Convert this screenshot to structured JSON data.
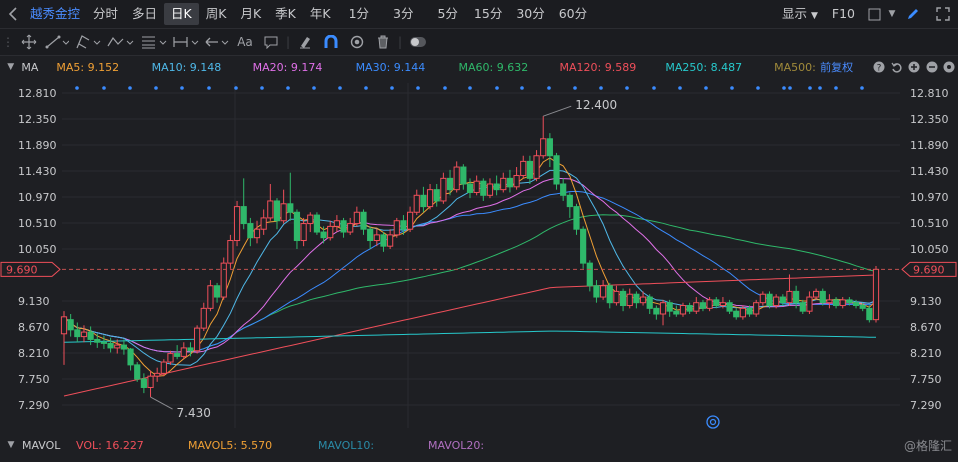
{
  "header": {
    "stock_name": "越秀金控",
    "periods": [
      "分时",
      "多日",
      "日K",
      "周K",
      "月K",
      "季K",
      "年K",
      "1分",
      "3分",
      "5分",
      "15分",
      "30分",
      "60分"
    ],
    "active_period": "日K",
    "display_label": "显示",
    "f10_label": "F10"
  },
  "toolbar": {
    "text_tool": "Aa"
  },
  "indicators": {
    "main_label": "MA",
    "ma5": "MA5: 9.152",
    "ma10": "MA10: 9.148",
    "ma20": "MA20: 9.174",
    "ma30": "MA30: 9.144",
    "ma60": "MA60: 9.632",
    "ma120": "MA120: 9.589",
    "ma250": "MA250: 8.487",
    "ma500": "MA500: ",
    "adjust": "前复权",
    "colors": {
      "ma5": "#f0a035",
      "ma10": "#4fb8e8",
      "ma20": "#e070e8",
      "ma30": "#3b8cff",
      "ma60": "#2fb86a",
      "ma120": "#ef4f5a",
      "ma250": "#27c9cc",
      "ma500": "#a08a3a",
      "up": "#ef4f5a",
      "down": "#2fb86a"
    }
  },
  "volume": {
    "label": "MAVOL",
    "vol": "VOL: 16.227",
    "mavol5": "MAVOL5: 5.570",
    "mavol10": "MAVOL10:",
    "mavol20": "MAVOL20:",
    "colors": {
      "vol": "#ef4f5a",
      "mavol5": "#f0a035",
      "mavol10": "#2a8aa6",
      "mavol20": "#b070c0"
    }
  },
  "watermark": "@格隆汇",
  "chart_data": {
    "type": "candlestick",
    "y_ticks": [
      "12.810",
      "12.350",
      "11.890",
      "11.430",
      "10.970",
      "10.510",
      "10.050",
      "9.690",
      "9.130",
      "8.670",
      "8.210",
      "7.750",
      "7.290"
    ],
    "current_price": "9.690",
    "annotations": {
      "high": "12.400",
      "low": "7.430"
    },
    "ylim": [
      7.0,
      13.0
    ],
    "candles": [
      [
        8.55,
        8.85,
        8.95,
        8.0
      ],
      [
        8.8,
        8.62,
        8.9,
        8.5
      ],
      [
        8.62,
        8.5,
        8.75,
        8.4
      ],
      [
        8.5,
        8.58,
        8.7,
        8.4
      ],
      [
        8.58,
        8.45,
        8.68,
        8.35
      ],
      [
        8.45,
        8.4,
        8.55,
        8.3
      ],
      [
        8.4,
        8.38,
        8.52,
        8.28
      ],
      [
        8.38,
        8.3,
        8.48,
        8.22
      ],
      [
        8.3,
        8.35,
        8.45,
        8.2
      ],
      [
        8.35,
        8.28,
        8.45,
        8.18
      ],
      [
        8.28,
        8.0,
        8.3,
        7.9
      ],
      [
        8.0,
        7.75,
        8.05,
        7.7
      ],
      [
        7.75,
        7.6,
        7.85,
        7.5
      ],
      [
        7.6,
        7.8,
        7.9,
        7.43
      ],
      [
        7.8,
        7.85,
        7.95,
        7.7
      ],
      [
        7.85,
        8.05,
        8.1,
        7.8
      ],
      [
        8.05,
        8.2,
        8.25,
        8.0
      ],
      [
        8.2,
        8.15,
        8.35,
        8.1
      ],
      [
        8.15,
        8.3,
        8.4,
        8.1
      ],
      [
        8.3,
        8.25,
        8.4,
        8.15
      ],
      [
        8.25,
        8.65,
        8.7,
        8.2
      ],
      [
        8.65,
        9.0,
        9.1,
        8.6
      ],
      [
        9.0,
        9.4,
        9.5,
        8.95
      ],
      [
        9.4,
        9.2,
        9.45,
        9.1
      ],
      [
        9.2,
        9.8,
        9.9,
        9.15
      ],
      [
        9.8,
        10.2,
        10.3,
        9.7
      ],
      [
        10.2,
        10.8,
        10.9,
        10.1
      ],
      [
        10.8,
        10.5,
        11.3,
        10.4
      ],
      [
        10.5,
        10.25,
        10.6,
        10.1
      ],
      [
        10.25,
        10.4,
        10.55,
        10.15
      ],
      [
        10.4,
        10.6,
        10.75,
        10.3
      ],
      [
        10.6,
        10.9,
        11.2,
        10.55
      ],
      [
        10.9,
        10.55,
        10.95,
        10.4
      ],
      [
        10.55,
        10.85,
        11.1,
        10.5
      ],
      [
        10.85,
        10.7,
        11.4,
        10.55
      ],
      [
        10.7,
        10.2,
        10.75,
        10.05
      ],
      [
        10.2,
        10.5,
        10.6,
        10.1
      ],
      [
        10.5,
        10.65,
        10.7,
        10.35
      ],
      [
        10.65,
        10.35,
        10.7,
        10.3
      ],
      [
        10.35,
        10.25,
        10.45,
        10.15
      ],
      [
        10.25,
        10.45,
        10.55,
        10.2
      ],
      [
        10.45,
        10.55,
        10.65,
        10.35
      ],
      [
        10.55,
        10.35,
        10.6,
        10.25
      ],
      [
        10.35,
        10.5,
        10.6,
        10.3
      ],
      [
        10.5,
        10.7,
        10.8,
        10.45
      ],
      [
        10.7,
        10.4,
        10.75,
        10.3
      ],
      [
        10.4,
        10.2,
        10.45,
        10.05
      ],
      [
        10.2,
        10.3,
        10.4,
        10.1
      ],
      [
        10.3,
        10.1,
        10.35,
        10.0
      ],
      [
        10.1,
        10.3,
        10.4,
        10.05
      ],
      [
        10.3,
        10.55,
        10.6,
        10.25
      ],
      [
        10.55,
        10.4,
        10.65,
        10.3
      ],
      [
        10.4,
        10.7,
        10.8,
        10.35
      ],
      [
        10.7,
        11.0,
        11.1,
        10.65
      ],
      [
        11.0,
        10.8,
        11.15,
        10.7
      ],
      [
        10.8,
        11.1,
        11.2,
        10.75
      ],
      [
        11.1,
        10.9,
        11.2,
        10.8
      ],
      [
        10.9,
        11.3,
        11.4,
        10.85
      ],
      [
        11.3,
        11.1,
        11.45,
        11.0
      ],
      [
        11.1,
        11.5,
        11.6,
        11.05
      ],
      [
        11.5,
        11.2,
        11.55,
        11.1
      ],
      [
        11.2,
        11.05,
        11.3,
        10.95
      ],
      [
        11.05,
        11.25,
        11.35,
        11.0
      ],
      [
        11.25,
        11.0,
        11.3,
        10.9
      ],
      [
        11.0,
        11.2,
        11.3,
        10.95
      ],
      [
        11.2,
        11.1,
        11.35,
        11.0
      ],
      [
        11.1,
        11.3,
        11.4,
        11.05
      ],
      [
        11.3,
        11.15,
        11.45,
        11.05
      ],
      [
        11.15,
        11.35,
        11.5,
        11.1
      ],
      [
        11.35,
        11.6,
        11.7,
        11.3
      ],
      [
        11.6,
        11.3,
        11.7,
        11.2
      ],
      [
        11.3,
        11.7,
        11.8,
        11.25
      ],
      [
        11.7,
        12.0,
        12.4,
        11.65
      ],
      [
        12.0,
        11.7,
        12.1,
        11.5
      ],
      [
        11.7,
        11.2,
        11.75,
        11.1
      ],
      [
        11.2,
        11.0,
        11.3,
        10.9
      ],
      [
        11.0,
        10.8,
        11.05,
        10.6
      ],
      [
        10.8,
        10.4,
        10.85,
        10.3
      ],
      [
        10.4,
        9.8,
        10.45,
        9.7
      ],
      [
        9.8,
        9.4,
        9.85,
        9.3
      ],
      [
        9.4,
        9.2,
        9.5,
        9.1
      ],
      [
        9.2,
        9.4,
        9.5,
        9.15
      ],
      [
        9.4,
        9.1,
        9.45,
        9.0
      ],
      [
        9.1,
        9.3,
        9.4,
        9.05
      ],
      [
        9.3,
        9.05,
        9.35,
        8.95
      ],
      [
        9.05,
        9.25,
        9.35,
        9.0
      ],
      [
        9.25,
        9.1,
        9.3,
        9.0
      ],
      [
        9.1,
        9.2,
        9.3,
        9.05
      ],
      [
        9.2,
        9.0,
        9.25,
        8.9
      ],
      [
        9.0,
        8.9,
        9.05,
        8.8
      ],
      [
        8.9,
        9.1,
        9.15,
        8.7
      ],
      [
        9.1,
        8.95,
        9.15,
        8.85
      ],
      [
        8.95,
        8.9,
        9.05,
        8.85
      ],
      [
        8.9,
        9.05,
        9.1,
        8.85
      ],
      [
        9.05,
        8.95,
        9.1,
        8.9
      ],
      [
        8.95,
        9.1,
        9.2,
        8.9
      ],
      [
        9.1,
        9.0,
        9.15,
        8.95
      ],
      [
        9.0,
        9.15,
        9.2,
        8.95
      ],
      [
        9.15,
        9.05,
        9.2,
        9.0
      ],
      [
        9.05,
        9.1,
        9.2,
        9.0
      ],
      [
        9.1,
        8.95,
        9.15,
        8.9
      ],
      [
        8.95,
        8.85,
        9.0,
        8.8
      ],
      [
        8.85,
        9.0,
        9.05,
        8.8
      ],
      [
        9.0,
        8.9,
        9.05,
        8.85
      ],
      [
        8.9,
        9.1,
        9.15,
        8.85
      ],
      [
        9.1,
        9.25,
        9.3,
        9.05
      ],
      [
        9.25,
        9.05,
        9.3,
        9.0
      ],
      [
        9.05,
        9.2,
        9.25,
        9.0
      ],
      [
        9.2,
        9.1,
        9.25,
        9.05
      ],
      [
        9.1,
        9.3,
        9.6,
        9.05
      ],
      [
        9.3,
        9.1,
        9.4,
        9.0
      ],
      [
        9.1,
        8.95,
        9.15,
        8.9
      ],
      [
        8.95,
        9.2,
        9.3,
        8.9
      ],
      [
        9.2,
        9.3,
        9.35,
        9.15
      ],
      [
        9.3,
        9.1,
        9.35,
        9.05
      ],
      [
        9.1,
        9.15,
        9.25,
        9.0
      ],
      [
        9.15,
        9.05,
        9.2,
        9.0
      ],
      [
        9.05,
        9.15,
        9.2,
        9.0
      ],
      [
        9.15,
        9.1,
        9.2,
        9.05
      ],
      [
        9.1,
        9.05,
        9.15,
        9.0
      ],
      [
        9.05,
        9.0,
        9.1,
        8.95
      ],
      [
        9.0,
        8.8,
        9.05,
        8.75
      ],
      [
        8.8,
        9.69,
        9.75,
        8.75
      ]
    ]
  }
}
